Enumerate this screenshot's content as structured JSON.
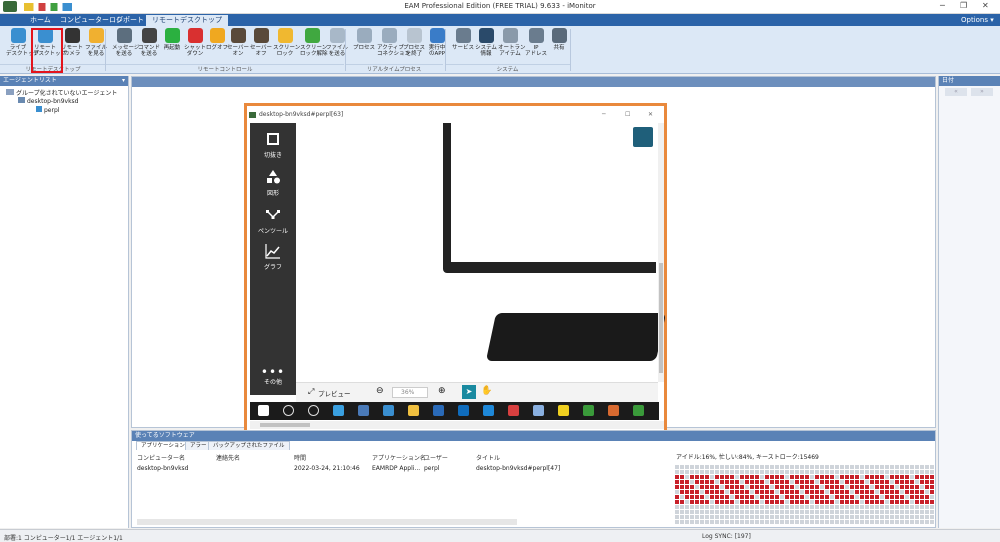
{
  "window": {
    "title": "EAM Professional Edition (FREE TRIAL) 9.633 - iMonitor"
  },
  "menu_tabs": [
    "ホーム",
    "コンピューターログ",
    "レポート",
    "リモートデスクトップ"
  ],
  "options_label": "Options ▾",
  "ribbon": {
    "buttons": [
      {
        "label": "ライブ\nデスクトップ",
        "icon": "monitor-icon",
        "color": "#3a8fd0"
      },
      {
        "label": "リモート\nデスクトップ",
        "icon": "remote-desktop-icon",
        "color": "#3a8fd0"
      },
      {
        "label": "リモート\nカメラ",
        "icon": "camera-icon",
        "color": "#333333"
      },
      {
        "label": "ファイル\nを見る",
        "icon": "folder-icon",
        "color": "#f0b030"
      },
      {
        "label": "メッセージ\nを送る",
        "icon": "message-icon",
        "color": "#5c6e7e"
      },
      {
        "label": "コマンド\nを送る",
        "icon": "command-icon",
        "color": "#444444"
      },
      {
        "label": "再起動",
        "icon": "restart-icon",
        "color": "#2bb040"
      },
      {
        "label": "シャット\nダウン",
        "icon": "shutdown-icon",
        "color": "#d93030"
      },
      {
        "label": "ログオフ",
        "icon": "logoff-icon",
        "color": "#f0a820"
      },
      {
        "label": "セーバー\nオン",
        "icon": "screensaver-on-icon",
        "color": "#5a4a3a"
      },
      {
        "label": "セーバー\nオフ",
        "icon": "screensaver-off-icon",
        "color": "#5a4a3a"
      },
      {
        "label": "スクリーン\nロック",
        "icon": "lock-screen-icon",
        "color": "#f0b830"
      },
      {
        "label": "スクリーン\nロック解除",
        "icon": "unlock-screen-icon",
        "color": "#40a840"
      },
      {
        "label": "ファイル\nを送る",
        "icon": "send-file-icon",
        "color": "#a8b8c8"
      },
      {
        "label": "プロセス",
        "icon": "process-icon",
        "color": "#9aacbe"
      },
      {
        "label": "アクティブ\nコネクション",
        "icon": "connection-icon",
        "color": "#9aacbe"
      },
      {
        "label": "プロセス\nを終了",
        "icon": "kill-process-icon",
        "color": "#b8c4d0"
      },
      {
        "label": "実行中\nのAPP",
        "icon": "running-app-icon",
        "color": "#3a7cc8"
      },
      {
        "label": "サービス",
        "icon": "service-icon",
        "color": "#6a7c8e"
      },
      {
        "label": "システム\n情報",
        "icon": "system-info-icon",
        "color": "#2a4a6a"
      },
      {
        "label": "オートラン\nアイテム",
        "icon": "autorun-icon",
        "color": "#8a9aaa"
      },
      {
        "label": "IP\nアドレス",
        "icon": "ip-address-icon",
        "color": "#6a7c8e"
      },
      {
        "label": "共有",
        "icon": "share-icon",
        "color": "#5a6a7a"
      }
    ],
    "groups": [
      "リモートデスクトップ",
      "リモートコントロール",
      "リアルタイムプロセス",
      "システム"
    ]
  },
  "left_panel": {
    "title": "エージェントリスト",
    "tree": [
      "グループ化されていないエージェント",
      "desktop-bn9vksd",
      "perpl"
    ]
  },
  "right_panel": {
    "title": "日付"
  },
  "remote_window": {
    "title": "desktop-bn9vksd#perpl[63]",
    "sidebar": [
      "切抜き",
      "図形",
      "ペンツール",
      "グラフ",
      "その他"
    ],
    "toolbar": {
      "preview": "プレビュー",
      "zoom": "36%"
    }
  },
  "bottom_panel": {
    "title": "使ってるソフトウェア",
    "tabs": [
      "アプリケーション",
      "アラート",
      "バックアップされたファイル"
    ],
    "columns": [
      "コンピューター名",
      "連絡先名",
      "時間",
      "アプリケーション名",
      "ユーザー",
      "タイトル"
    ],
    "rows": [
      [
        "desktop-bn9vksd",
        "",
        "2022-03-24, 21:10:46",
        "EAMRDP Appli...",
        "perpl",
        "desktop-bn9vksd#perpl[47]"
      ]
    ],
    "activity": "アイドル:16%, 忙しい:84%, キーストローク:15469"
  },
  "status": {
    "left": "部署:1 コンピューター1/1 エージェント1/1",
    "right": "Log SYNC: [197]"
  },
  "colors": {
    "highlight": "#e3141c",
    "window_border": "#e9893c",
    "panel_header": "#5a82b6"
  }
}
